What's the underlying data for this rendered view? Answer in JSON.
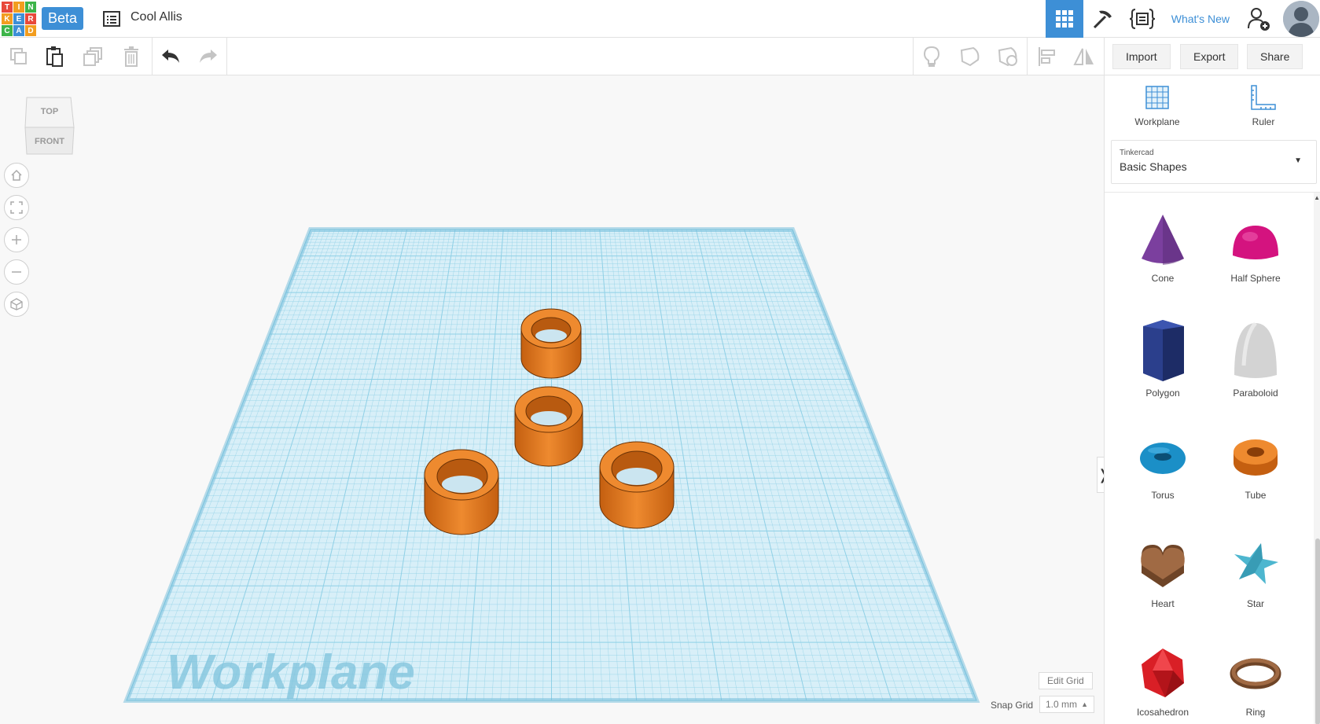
{
  "app": {
    "logo_letters": [
      "T",
      "I",
      "N",
      "K",
      "E",
      "R",
      "C",
      "A",
      "D"
    ],
    "beta_label": "Beta",
    "project_name": "Cool Allis",
    "whats_new": "What's New"
  },
  "toolbar": {
    "import_label": "Import",
    "export_label": "Export",
    "share_label": "Share"
  },
  "viewcube": {
    "top_label": "TOP",
    "front_label": "FRONT"
  },
  "workplane": {
    "watermark": "Workplane",
    "edit_grid_label": "Edit Grid",
    "snap_grid_label": "Snap Grid",
    "snap_grid_value": "1.0 mm"
  },
  "panel": {
    "workplane_label": "Workplane",
    "ruler_label": "Ruler",
    "library_source": "Tinkercad",
    "library_name": "Basic Shapes",
    "shapes": [
      {
        "name": "Cone",
        "color": "#7b3f9e"
      },
      {
        "name": "Half Sphere",
        "color": "#d4137f"
      },
      {
        "name": "Polygon",
        "color": "#2b3f8c"
      },
      {
        "name": "Paraboloid",
        "color": "#cfcfcf"
      },
      {
        "name": "Torus",
        "color": "#1b8fc7"
      },
      {
        "name": "Tube",
        "color": "#e0761c"
      },
      {
        "name": "Heart",
        "color": "#8a5a38"
      },
      {
        "name": "Star",
        "color": "#4db6cf"
      },
      {
        "name": "Icosahedron",
        "color": "#d91f26"
      },
      {
        "name": "Ring",
        "color": "#8a5a38"
      }
    ]
  },
  "colors": {
    "accent": "#3d8fd6",
    "workplane_grid": "#8fd0e6",
    "tube_orange": "#e0761c"
  }
}
